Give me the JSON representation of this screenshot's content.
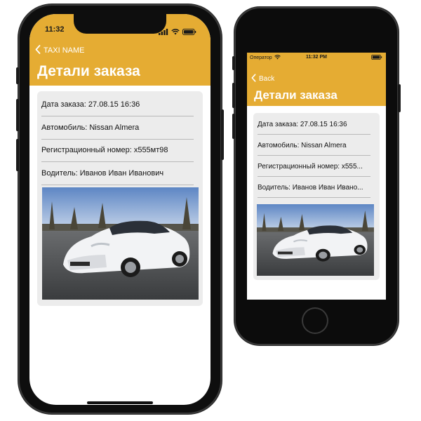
{
  "colors": {
    "accent": "#e5ac33",
    "card": "#ececec",
    "divider": "#b9b9b9"
  },
  "phone_large": {
    "status_time": "11:32",
    "status_icons": [
      "signal-icon",
      "wifi-icon",
      "battery-icon"
    ],
    "nav_back_label": "TAXI NAME",
    "title": "Детали заказа",
    "rows": [
      "Дата заказа: 27.08.15 16:36",
      "Автомобиль: Nissan Almera",
      "Регистрационный номер: х555мт98",
      "Водитель: Иванов Иван Иванович"
    ],
    "photo": "white-nissan-almera-photo"
  },
  "phone_small": {
    "carrier": "Оператор",
    "status_time": "11:32 PM",
    "status_icons": [
      "wifi-icon",
      "battery-icon"
    ],
    "nav_back_label": "Back",
    "title": "Детали заказа",
    "rows": [
      "Дата заказа: 27.08.15 16:36",
      "Автомобиль: Nissan Almera",
      "Регистрационный номер: х555...",
      "Водитель: Иванов Иван Ивано..."
    ],
    "photo": "white-nissan-almera-photo"
  }
}
